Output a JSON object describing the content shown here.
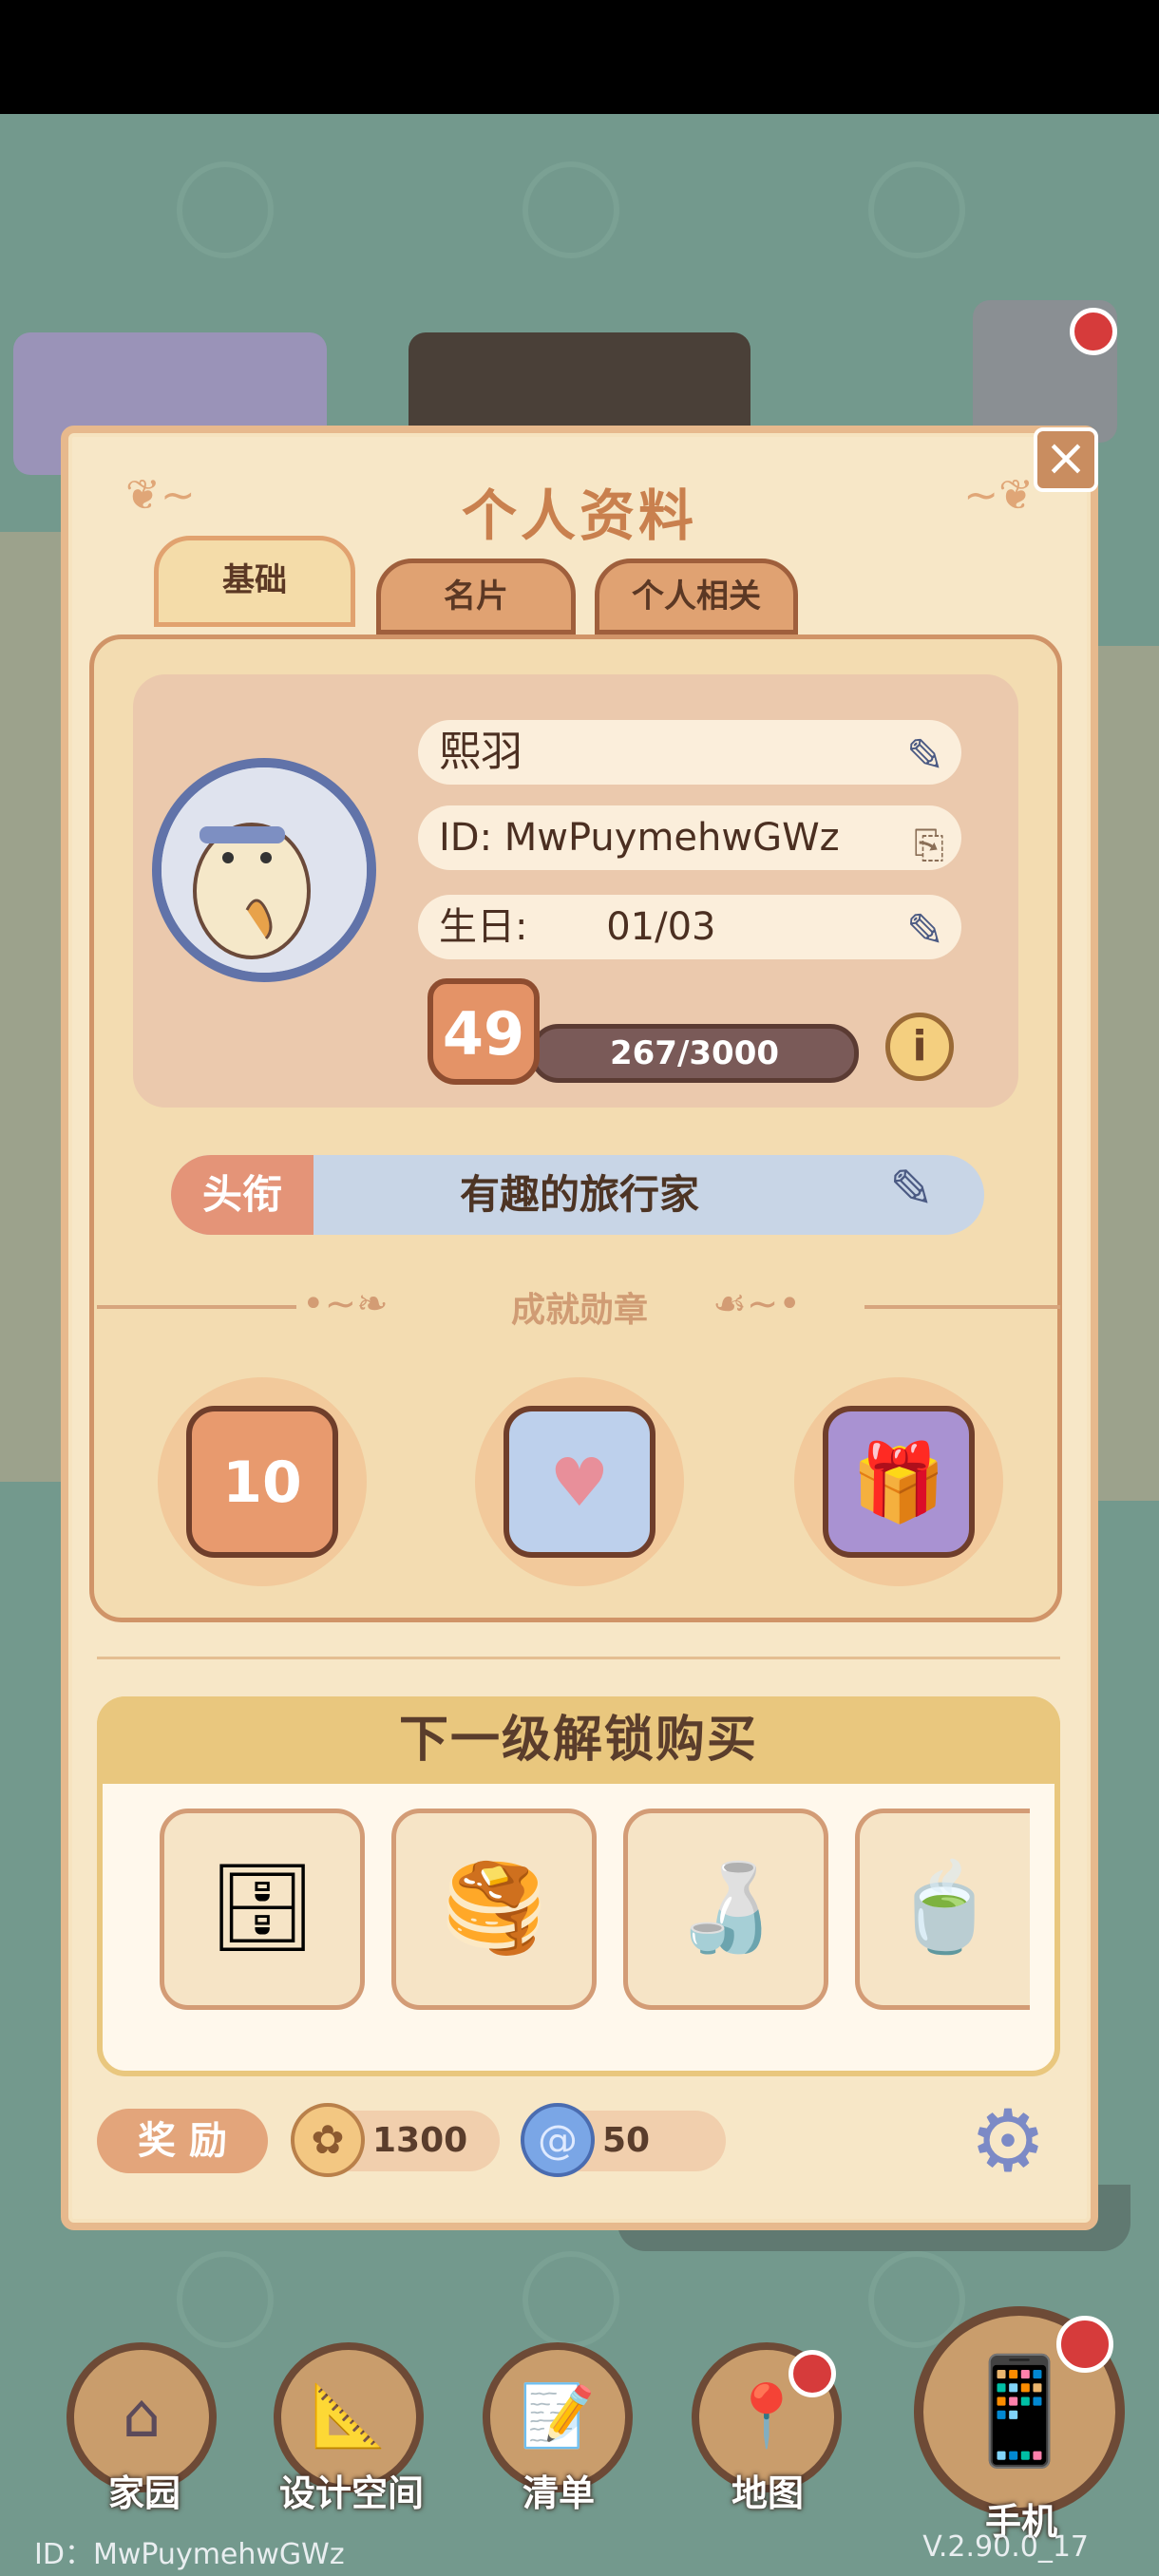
{
  "modal": {
    "title": "个人资料",
    "tabs": [
      {
        "label": "基础"
      },
      {
        "label": "名片"
      },
      {
        "label": "个人相关"
      }
    ],
    "active_tab": "基础"
  },
  "profile": {
    "name": "熙羽",
    "id_text": "ID: MwPuymehwGWz",
    "birthday_label": "生日:",
    "birthday_value": "01/03",
    "level": "49",
    "xp_text": "267/3000"
  },
  "title_tag": {
    "label": "头衔",
    "value": "有趣的旅行家"
  },
  "achievements": {
    "section_label": "成就勋章",
    "medals": [
      {
        "icon": "badge-10-icon",
        "text": "10"
      },
      {
        "icon": "heart-chat-icon"
      },
      {
        "icon": "gift-box-icon"
      }
    ]
  },
  "unlock": {
    "heading": "下一级解锁购买",
    "items": [
      {
        "icon": "wooden-cabinet-icon"
      },
      {
        "icon": "pancake-plate-icon"
      },
      {
        "icon": "sauce-bottles-icon"
      },
      {
        "icon": "tea-set-icon"
      }
    ]
  },
  "reward": {
    "label": "奖 励",
    "coins": "1300",
    "gems": "50"
  },
  "nav": [
    {
      "label": "家园",
      "icon": "house-icon"
    },
    {
      "label": "设计空间",
      "icon": "ruler-icon"
    },
    {
      "label": "清单",
      "icon": "list-icon"
    },
    {
      "label": "地图",
      "icon": "map-pin-icon"
    },
    {
      "label": "手机",
      "icon": "phone-icon"
    }
  ],
  "footer": {
    "id_text": "ID：MwPuymehwGWz",
    "version": "V.2.90.0_17"
  },
  "colors": {
    "background": "#73998d",
    "modal": "#f7e7c7",
    "accent": "#e49367",
    "title_tag_bg": "#c8d5e6"
  }
}
